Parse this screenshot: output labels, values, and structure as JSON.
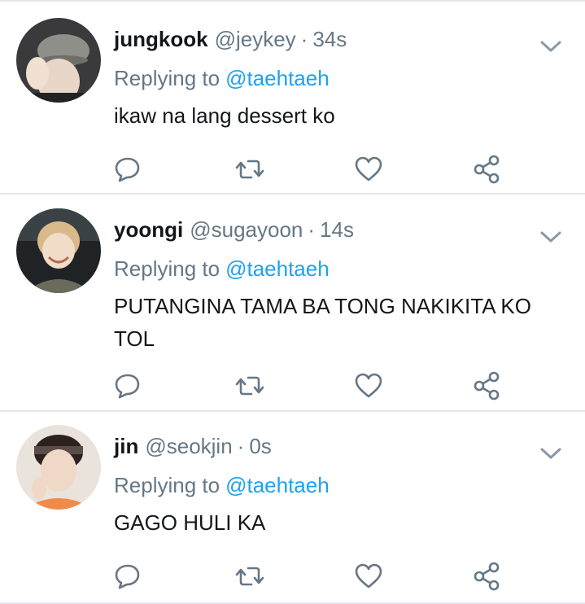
{
  "colors": {
    "text_primary": "#14171a",
    "text_secondary": "#657786",
    "link": "#1da1f2",
    "icon": "#657786",
    "divider": "#e3e7eb"
  },
  "icons": {
    "reply": "speech-bubble-icon",
    "retweet": "retweet-icon",
    "like": "heart-icon",
    "share": "share-icon",
    "more": "chevron-down-icon"
  },
  "tweets": [
    {
      "name": "jungkook",
      "handle": "@jeykey",
      "separator": "·",
      "time": "34s",
      "replying_prefix": "Replying to",
      "replying_handle": "@taehtaeh",
      "text": "ikaw na lang dessert ko"
    },
    {
      "name": "yoongi",
      "handle": "@sugayoon",
      "separator": "·",
      "time": "14s",
      "replying_prefix": "Replying to",
      "replying_handle": "@taehtaeh",
      "text": "PUTANGINA TAMA BA TONG NAKIKITA KO TOL"
    },
    {
      "name": "jin",
      "handle": "@seokjin",
      "separator": "·",
      "time": "0s",
      "replying_prefix": "Replying to",
      "replying_handle": "@taehtaeh",
      "text": "GAGO HULI KA"
    }
  ]
}
